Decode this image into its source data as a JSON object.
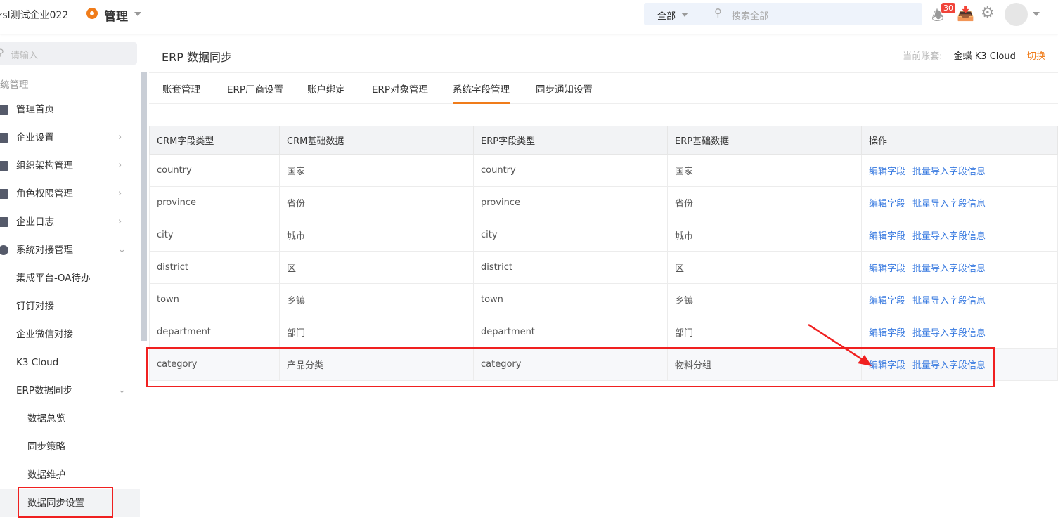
{
  "header": {
    "company": "zsl测试企业022",
    "module": "管理",
    "search_scope": "全部",
    "search_placeholder": "搜索全部",
    "notification_count": "30"
  },
  "sidebar": {
    "search_placeholder": "请输入",
    "section": "统管理",
    "items": [
      {
        "label": "管理首页"
      },
      {
        "label": "企业设置"
      },
      {
        "label": "组织架构管理"
      },
      {
        "label": "角色权限管理"
      },
      {
        "label": "企业日志"
      },
      {
        "label": "系统对接管理"
      },
      {
        "label": "集成平台-OA待办"
      },
      {
        "label": "钉钉对接"
      },
      {
        "label": "企业微信对接"
      },
      {
        "label": "K3 Cloud"
      },
      {
        "label": "ERP数据同步"
      },
      {
        "label": "数据总览"
      },
      {
        "label": "同步策略"
      },
      {
        "label": "数据维护"
      },
      {
        "label": "数据同步设置"
      }
    ]
  },
  "main": {
    "title": "ERP 数据同步",
    "account_label": "当前账套:",
    "account_value": "金蝶 K3 Cloud",
    "switch_label": "切换",
    "tabs": [
      "账套管理",
      "ERP厂商设置",
      "账户绑定",
      "ERP对象管理",
      "系统字段管理",
      "同步通知设置"
    ],
    "table": {
      "headers": [
        "CRM字段类型",
        "CRM基础数据",
        "ERP字段类型",
        "ERP基础数据",
        "操作"
      ],
      "rows": [
        [
          "country",
          "国家",
          "country",
          "国家"
        ],
        [
          "province",
          "省份",
          "province",
          "省份"
        ],
        [
          "city",
          "城市",
          "city",
          "城市"
        ],
        [
          "district",
          "区",
          "district",
          "区"
        ],
        [
          "town",
          "乡镇",
          "town",
          "乡镇"
        ],
        [
          "department",
          "部门",
          "department",
          "部门"
        ],
        [
          "category",
          "产品分类",
          "category",
          "物料分组"
        ]
      ],
      "action_edit": "编辑字段",
      "action_import": "批量导入字段信息"
    }
  },
  "colors": {
    "accent": "#f07c1a",
    "link": "#3a7be0",
    "highlight": "#f02020"
  }
}
